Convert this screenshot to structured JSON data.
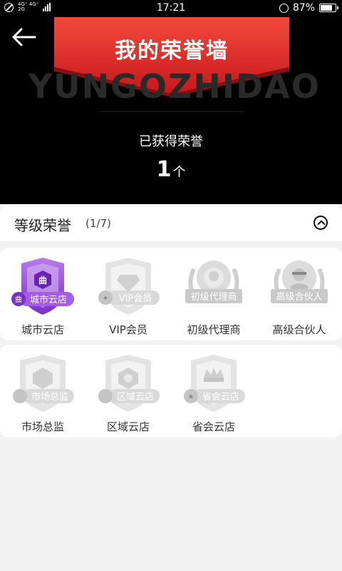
{
  "status_bar": {
    "time": "17:21",
    "network_top": "4G⁺ 4G⁺",
    "network_bottom": "2G",
    "battery": "87%"
  },
  "header": {
    "title": "我的荣誉墙",
    "watermark": "YUNGOZHIDAO",
    "earned_label": "已获得荣誉",
    "earned_count": "1",
    "earned_unit": "个"
  },
  "section": {
    "title": "等级荣誉",
    "progress": "(1/7)"
  },
  "badges": [
    {
      "label": "城市云店",
      "ribbon": "城市云店",
      "emblem": "曲",
      "earned": true
    },
    {
      "label": "VIP会员",
      "ribbon": "VIP会员",
      "earned": false
    },
    {
      "label": "初级代理商",
      "ribbon": "初级代理商",
      "earned": false
    },
    {
      "label": "高级合伙人",
      "ribbon": "高级合伙人",
      "earned": false
    },
    {
      "label": "市场总监",
      "ribbon": "市场总监",
      "earned": false
    },
    {
      "label": "区域云店",
      "ribbon": "区域云店",
      "earned": false
    },
    {
      "label": "省会云店",
      "ribbon": "省会云店",
      "earned": false
    }
  ],
  "colors": {
    "earned_purple": "#8b3fd6",
    "locked_gray": "#d9d9d9",
    "ribbon_red": "#e53227"
  }
}
